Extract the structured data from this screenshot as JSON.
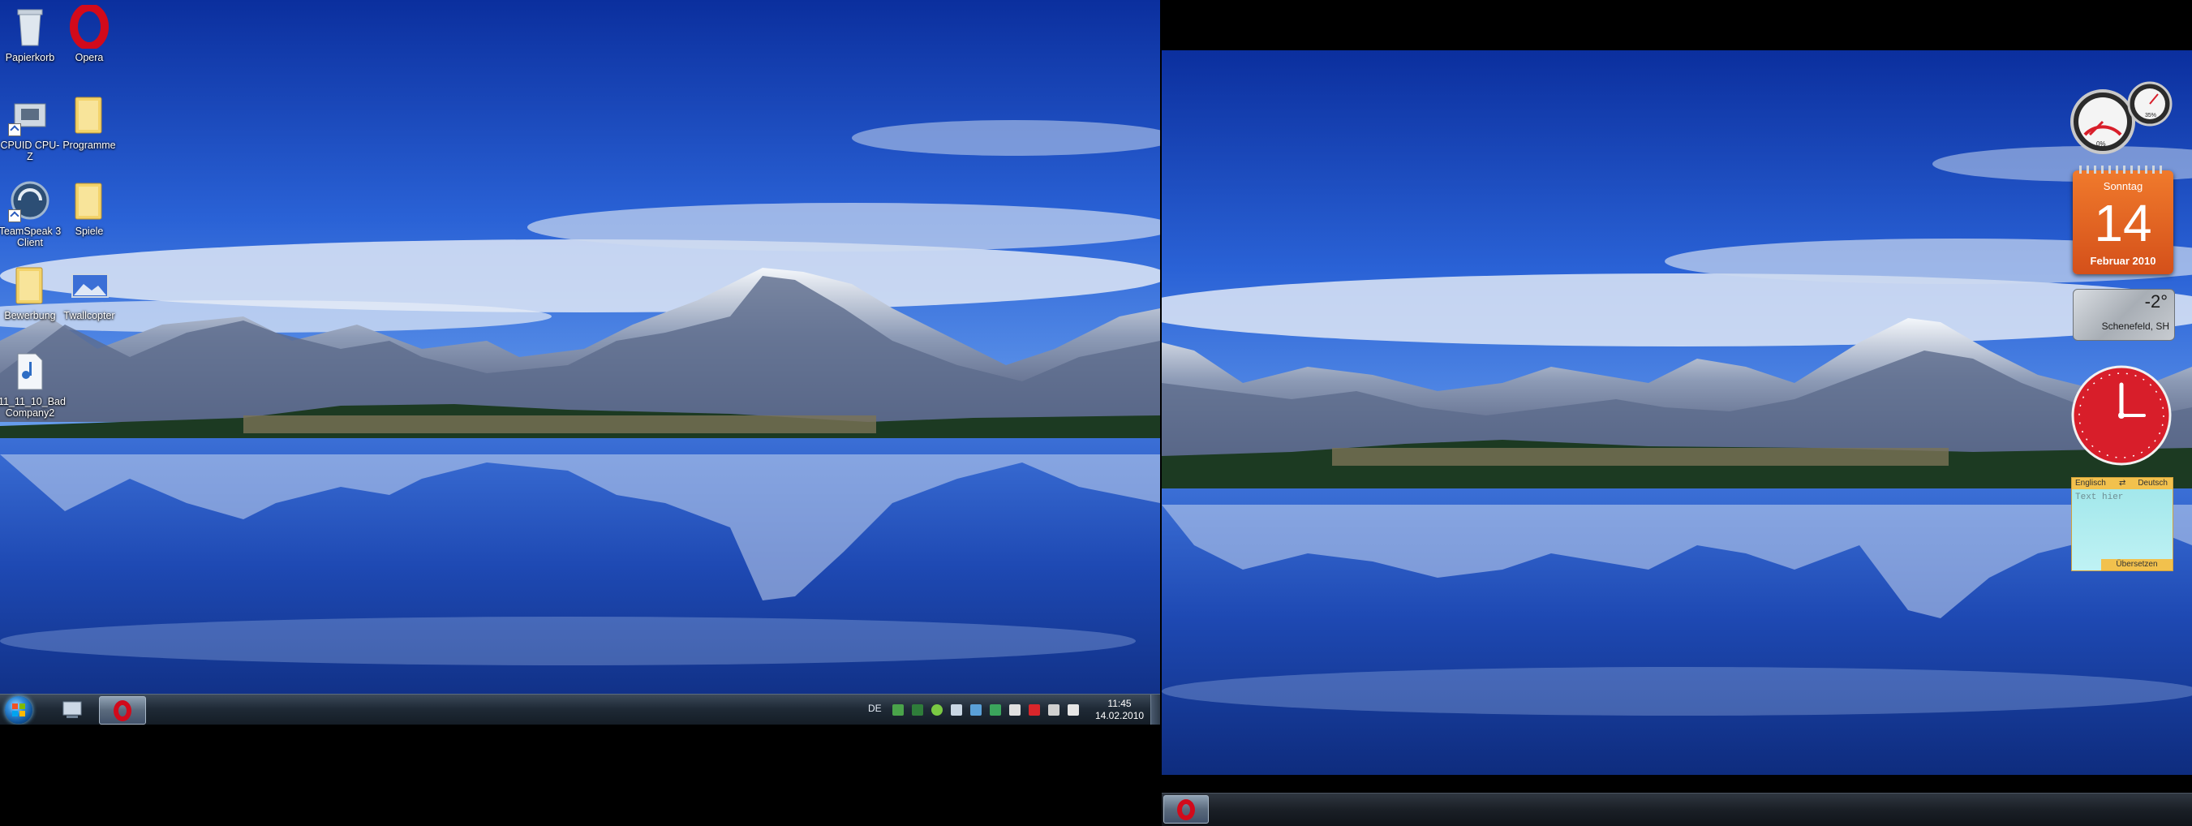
{
  "desktop_icons": [
    {
      "label": "Papierkorb",
      "icon": "recycle-bin-icon"
    },
    {
      "label": "Opera",
      "icon": "opera-icon"
    },
    {
      "label": "CPUID CPU-Z",
      "icon": "cpuz-icon"
    },
    {
      "label": "Programme",
      "icon": "folder-icon"
    },
    {
      "label": "TeamSpeak 3 Client",
      "icon": "teamspeak-icon"
    },
    {
      "label": "Spiele",
      "icon": "folder-icon"
    },
    {
      "label": "Bewerbung",
      "icon": "folder-icon"
    },
    {
      "label": "Twallcopter",
      "icon": "image-file-icon"
    },
    {
      "label": "11_11_10_Bad Company2",
      "icon": "mp3-file-icon"
    }
  ],
  "taskbar1": {
    "language": "DE",
    "time": "11:45",
    "date": "14.02.2010"
  },
  "gadgets": {
    "calendar": {
      "weekday": "Sonntag",
      "day": "14",
      "month_year": "Februar 2010"
    },
    "weather": {
      "temp": "-2°",
      "location": "Schenefeld, SH"
    },
    "translator": {
      "source_lang": "Englisch",
      "arrow": "⇄",
      "target_lang": "Deutsch",
      "placeholder": "Text hier",
      "button": "Übersetzen"
    },
    "cpu_meter": {
      "cpu": "0%",
      "ram": "35%"
    }
  },
  "colors": {
    "opera": "#d20a1b",
    "calendar": "#e0611f",
    "clock_red": "#d81e2a"
  }
}
